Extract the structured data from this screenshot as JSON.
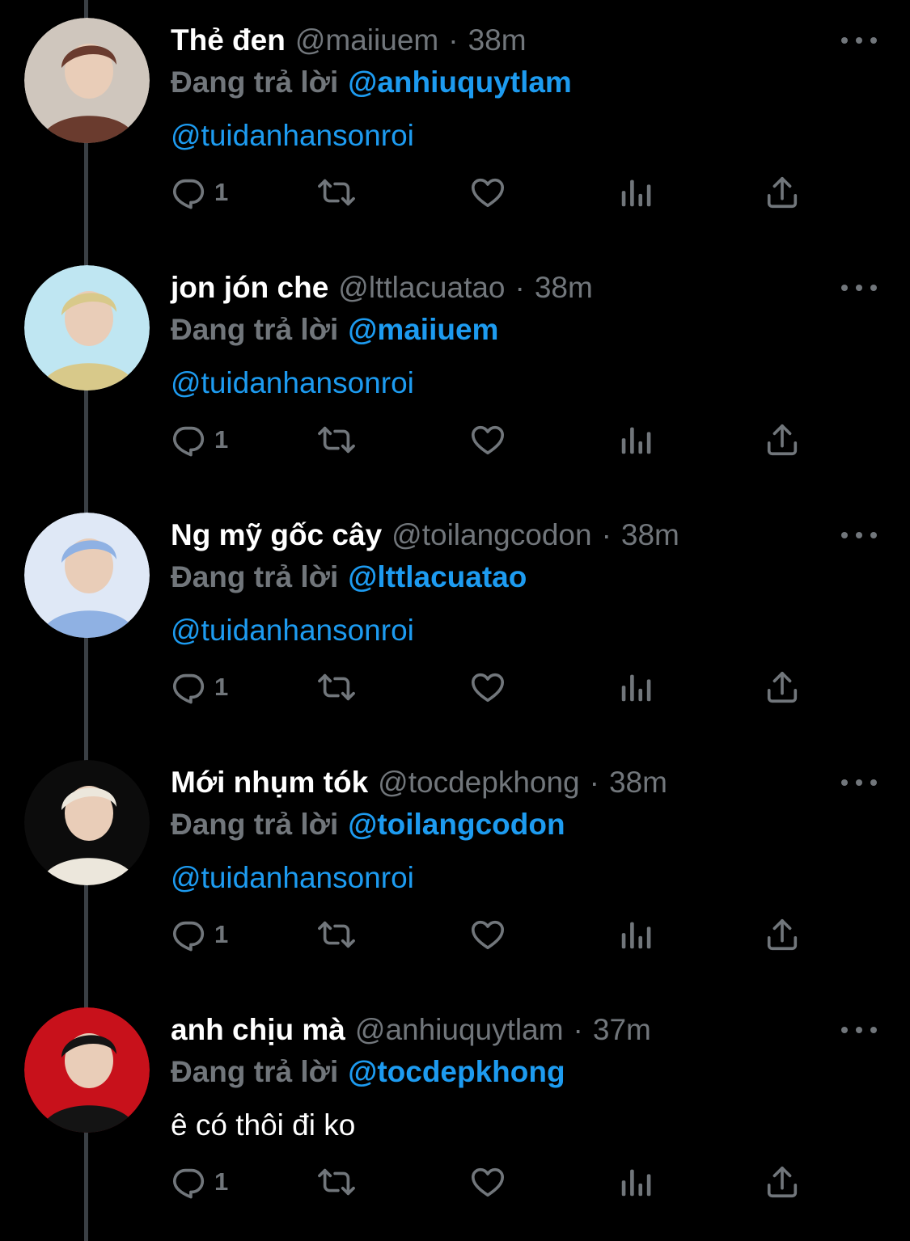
{
  "thread": {
    "tweets": [
      {
        "name": "Thẻ đen",
        "handle": "@maiiuem",
        "separator": "·",
        "time": "38m",
        "replying_label": "Đang trả lời",
        "replying_to": "@anhiuquytlam",
        "text": "@tuidanhansonroi",
        "text_style": "link",
        "reply_count": "1",
        "avatar_colors": [
          "#cfc6bd",
          "#6a3b2e"
        ]
      },
      {
        "name": "jon jón che",
        "handle": "@lttlacuatao",
        "separator": "·",
        "time": "38m",
        "replying_label": "Đang trả lời",
        "replying_to": "@maiiuem",
        "text": "@tuidanhansonroi",
        "text_style": "link",
        "reply_count": "1",
        "avatar_colors": [
          "#bfe6f2",
          "#d8c98a"
        ]
      },
      {
        "name": "Ng mỹ gốc cây",
        "handle": "@toilangcodon",
        "separator": "·",
        "time": "38m",
        "replying_label": "Đang trả lời",
        "replying_to": "@lttlacuatao",
        "text": "@tuidanhansonroi",
        "text_style": "link",
        "reply_count": "1",
        "avatar_colors": [
          "#dfe8f6",
          "#8fb1e3"
        ]
      },
      {
        "name": "Mới nhụm tók",
        "handle": "@tocdepkhong",
        "separator": "·",
        "time": "38m",
        "replying_label": "Đang trả lời",
        "replying_to": "@toilangcodon",
        "text": "@tuidanhansonroi",
        "text_style": "link",
        "reply_count": "1",
        "avatar_colors": [
          "#0c0c0c",
          "#ece7dc"
        ]
      },
      {
        "name": "anh chịu mà",
        "handle": "@anhiuquytlam",
        "separator": "·",
        "time": "37m",
        "replying_label": "Đang trả lời",
        "replying_to": "@tocdepkhong",
        "text": "ê có thôi đi ko",
        "text_style": "plain",
        "reply_count": "1",
        "avatar_colors": [
          "#c8111b",
          "#141414"
        ]
      }
    ],
    "icons": [
      "reply-icon",
      "retweet-icon",
      "like-icon",
      "analytics-icon",
      "share-icon",
      "more-icon"
    ]
  },
  "colors": {
    "background": "#000000",
    "text_primary": "#ffffff",
    "text_secondary": "#71767b",
    "accent": "#1d9bf0",
    "thread_line": "#3a3f44"
  }
}
